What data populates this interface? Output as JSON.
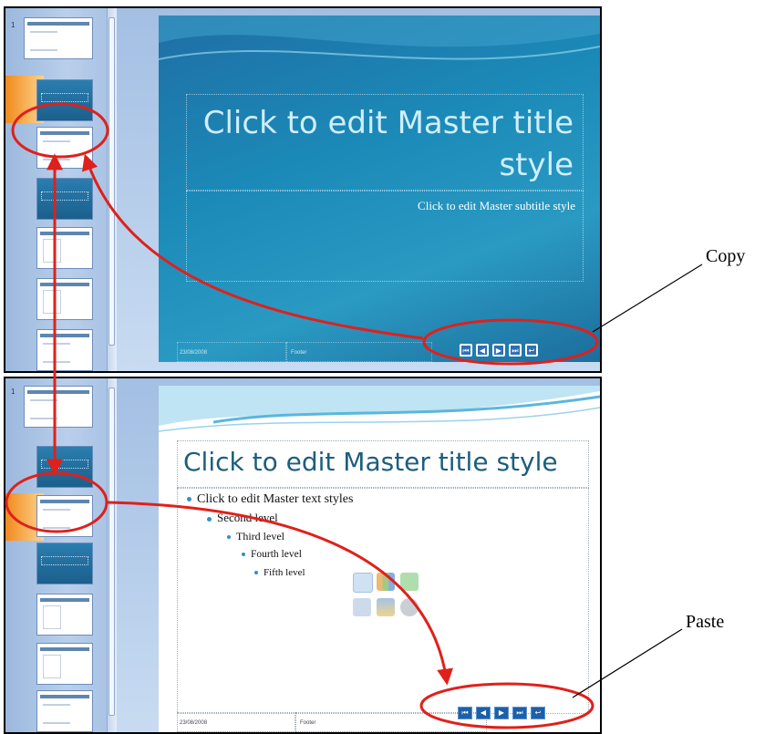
{
  "colors": {
    "arrow": "#e0201b",
    "slide_title_dark": "#cfeefb",
    "slide_title_light": "#1c5e7e"
  },
  "top_panel": {
    "thumbnail_numbers": [
      "1"
    ],
    "slide": {
      "title": "Click to edit Master title style",
      "title_line1": "Click to edit Master title",
      "title_line2": "style",
      "subtitle": "Click to edit Master subtitle style",
      "footer_date": "23/08/2008",
      "footer_text": "Footer"
    },
    "nav_buttons": [
      "⏮",
      "◀",
      "▶",
      "⏭",
      "↩"
    ]
  },
  "bottom_panel": {
    "thumbnail_numbers": [
      "1"
    ],
    "slide": {
      "title": "Click to edit Master title style",
      "text_levels": [
        "Click to edit Master text styles",
        "Second level",
        "Third level",
        "Fourth level",
        "Fifth level"
      ],
      "footer_date": "23/08/2008",
      "footer_text": "Footer"
    },
    "nav_buttons": [
      "⏮",
      "◀",
      "▶",
      "⏭",
      "↩"
    ]
  },
  "callouts": {
    "copy": "Copy",
    "paste": "Paste"
  },
  "icons": [
    "table-icon",
    "chart-icon",
    "smartart-icon",
    "picture-icon",
    "clipart-icon",
    "media-icon"
  ]
}
